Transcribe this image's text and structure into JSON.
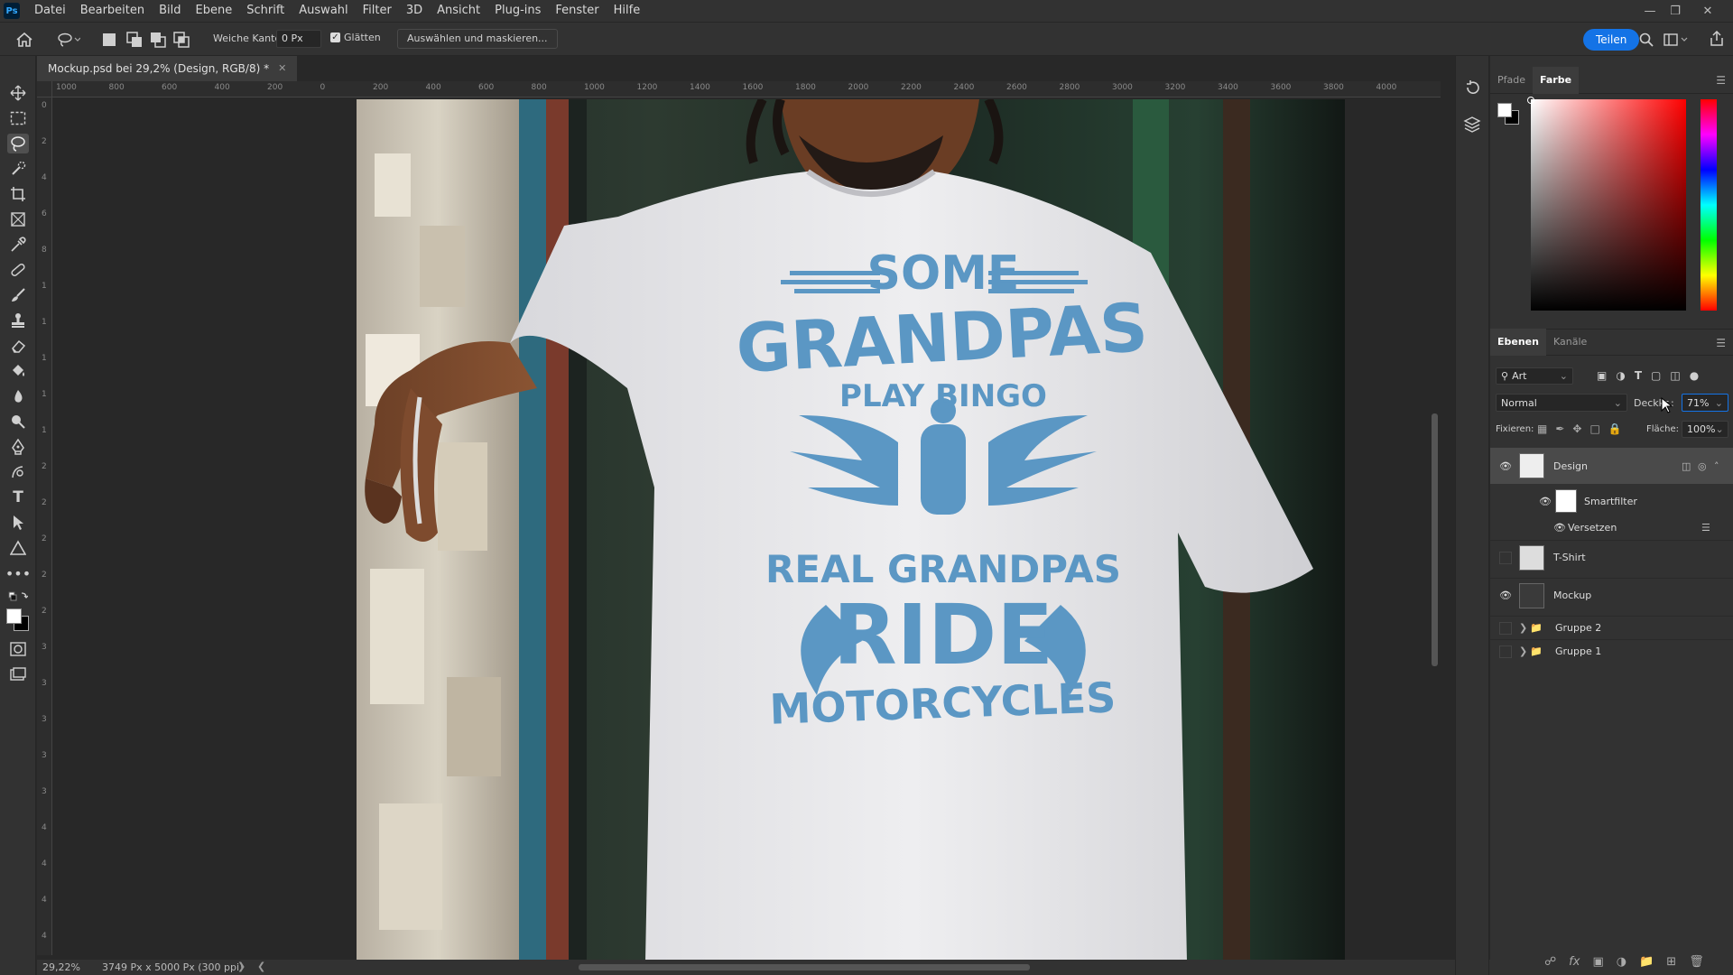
{
  "app": {
    "logo": "Ps"
  },
  "menu": [
    "Datei",
    "Bearbeiten",
    "Bild",
    "Ebene",
    "Schrift",
    "Auswahl",
    "Filter",
    "3D",
    "Ansicht",
    "Plug-ins",
    "Fenster",
    "Hilfe"
  ],
  "options": {
    "feather_label": "Weiche Kante:",
    "feather_value": "0 Px",
    "antialias_label": "Glätten",
    "antialias_checked": true,
    "select_mask_label": "Auswählen und maskieren...",
    "share_label": "Teilen"
  },
  "document": {
    "tab_title": "Mockup.psd bei 29,2% (Design, RGB/8) *",
    "zoom": "29,22%",
    "size_info": "3749 Px x 5000 Px (300 ppi)"
  },
  "ruler_top_ticks": [
    "1000",
    "800",
    "600",
    "400",
    "200",
    "0",
    "200",
    "400",
    "600",
    "800",
    "1000",
    "1200",
    "1400",
    "1600",
    "1800",
    "2000",
    "2200",
    "2400",
    "2600",
    "2800",
    "3000",
    "3200",
    "3400",
    "3600",
    "3800",
    "4000"
  ],
  "ruler_left_ticks": [
    "0",
    "2",
    "4",
    "6",
    "8",
    "1",
    "1",
    "1",
    "1",
    "1",
    "2",
    "2",
    "2",
    "2",
    "2",
    "3",
    "3",
    "3",
    "3",
    "3",
    "4",
    "4",
    "4",
    "4"
  ],
  "shirt_text": {
    "line1": "SOME",
    "line2": "GRANDPAS",
    "line3": "PLAY BINGO",
    "line4": "REAL GRANDPAS",
    "line5": "RIDE",
    "line6": "MOTORCYCLES"
  },
  "color_panel": {
    "tabs": [
      "Pfade",
      "Farbe"
    ],
    "active_tab": "Farbe",
    "hue_color": "#ff0000"
  },
  "layers_panel": {
    "tabs": [
      "Ebenen",
      "Kanäle"
    ],
    "active_tab": "Ebenen",
    "filter_label": "Art",
    "blend_mode": "Normal",
    "opacity_label": "Deckkr.:",
    "opacity_value": "71%",
    "lock_label": "Fixieren:",
    "fill_label": "Fläche:",
    "fill_value": "100%",
    "layers": [
      {
        "name": "Design",
        "visible": true,
        "selected": true
      },
      {
        "name": "Smartfilter",
        "visible": true,
        "sub": true
      },
      {
        "name": "Versetzen",
        "visible": true,
        "sub2": true
      },
      {
        "name": "T-Shirt",
        "visible": false
      },
      {
        "name": "Mockup",
        "visible": true
      },
      {
        "name": "Gruppe 2",
        "visible": false,
        "group": true
      },
      {
        "name": "Gruppe 1",
        "visible": false,
        "group": true
      }
    ]
  },
  "colors": {
    "accent": "#1473e6",
    "shirt_print": "#5b97c4",
    "bg": "#282828",
    "panel": "#323232"
  }
}
